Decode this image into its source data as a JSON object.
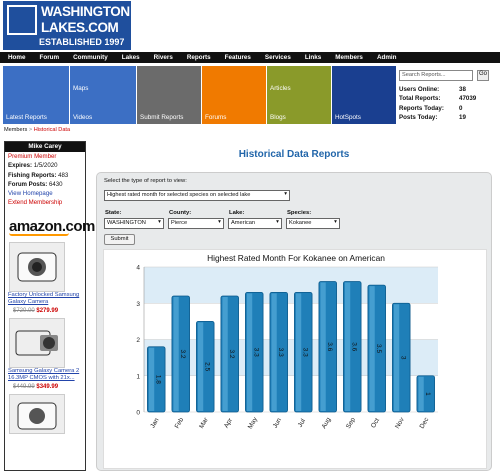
{
  "logo": {
    "line1": "WASHINGTON",
    "line2": "LAKES.COM",
    "line3": "ESTABLISHED 1997"
  },
  "nav": [
    "Home",
    "Forum",
    "Community",
    "Lakes",
    "Rivers",
    "Reports",
    "Features",
    "Services",
    "Links",
    "Members",
    "Admin"
  ],
  "tiles": [
    {
      "label": "Latest Reports",
      "color": "#3c6fc4"
    },
    {
      "label": "Maps",
      "color": "#f07a00"
    },
    {
      "label": "Videos",
      "color": "#3c6fc4"
    },
    {
      "label": "Submit Reports",
      "color": "#6b6b6b"
    },
    {
      "label": "Forums",
      "color": "#f07a00"
    },
    {
      "label": "Articles",
      "color": "#3c6fc4"
    },
    {
      "label": "Blogs",
      "color": "#8a9a2a"
    },
    {
      "label": "HotSpots",
      "color": "#1a3f90"
    }
  ],
  "search": {
    "placeholder": "Search Reports...",
    "go": "Go"
  },
  "stats": [
    {
      "label": "Users Online:",
      "value": "38"
    },
    {
      "label": "Total Reports:",
      "value": "47039"
    },
    {
      "label": "Reports Today:",
      "value": "0"
    },
    {
      "label": "Posts Today:",
      "value": "19"
    }
  ],
  "breadcrumb": {
    "members": "Members",
    "sep": ">",
    "current": "Historical Data"
  },
  "profile": {
    "name": "Mike Carey",
    "status": "Premium Member",
    "expires_label": "Expires:",
    "expires": "1/5/2020",
    "reports_label": "Fishing Reports:",
    "reports": "483",
    "posts_label": "Forum Posts:",
    "posts": "6430",
    "view_homepage": "View Homepage",
    "extend": "Extend Membership"
  },
  "amazon": {
    "brand": "amazon.com",
    "products": [
      {
        "name": "Factory Unlocked Samsung Galaxy Camera",
        "old_price": "$720.00",
        "price": "$279.99"
      },
      {
        "name": "Samsung Galaxy Camera 2 16.3MP CMOS with 21x...",
        "old_price": "$449.99",
        "price": "$349.99"
      }
    ]
  },
  "page": {
    "title": "Historical Data Reports",
    "report_type_label": "Select the type of report to view:",
    "report_type": "Highest rated month for selected species on selected lake",
    "state_label": "State:",
    "state": "WASHINGTON",
    "county_label": "County:",
    "county": "Pierce",
    "lake_label": "Lake:",
    "lake": "American",
    "species_label": "Species:",
    "species": "Kokanee",
    "submit": "Submit"
  },
  "colors": {
    "accent": "#2266aa",
    "bar": "#1f7fb8",
    "bar_dark": "#0b5a8c",
    "plot_band": "#dcecf7"
  },
  "chart_data": {
    "type": "bar",
    "title": "Highest Rated Month For Kokanee on American",
    "categories": [
      "Jan",
      "Feb",
      "Mar",
      "Apr",
      "May",
      "Jun",
      "Jul",
      "Aug",
      "Sep",
      "Oct",
      "Nov",
      "Dec"
    ],
    "values": [
      1.8,
      3.2,
      2.5,
      3.2,
      3.3,
      3.3,
      3.3,
      3.6,
      3.6,
      3.5,
      3.0,
      1.0
    ],
    "labels": [
      "1.8",
      "3.2",
      "2.5",
      "3.2",
      "3.3",
      "3.3",
      "3.3",
      "3.6",
      "3.6",
      "3.5",
      "3",
      "1"
    ],
    "ylim": [
      0,
      4
    ],
    "yticks": [
      0,
      1,
      2,
      3,
      4
    ],
    "grid": true,
    "legend": "none"
  }
}
